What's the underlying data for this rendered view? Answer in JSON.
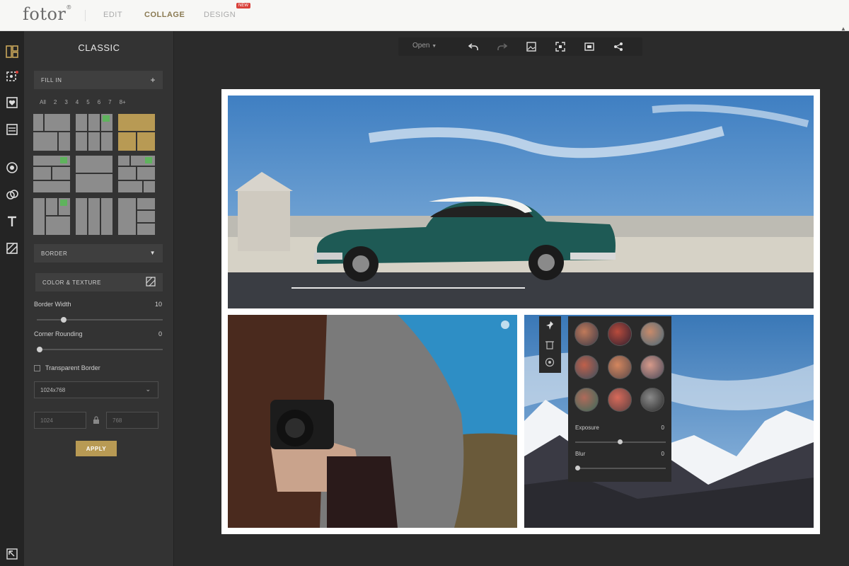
{
  "app": {
    "logo": "fotor",
    "logo_mark": "®"
  },
  "topnav": {
    "edit": "EDIT",
    "collage": "COLLAGE",
    "design": "DESIGN",
    "new_badge": "NEW"
  },
  "panel": {
    "title": "CLASSIC",
    "fill_in": "FILL IN",
    "counts": [
      "All",
      "2",
      "3",
      "4",
      "5",
      "6",
      "7",
      "8+"
    ],
    "border": "BORDER",
    "color_texture": "COLOR & TEXTURE",
    "border_width_label": "Border Width",
    "border_width_value": "10",
    "corner_rounding_label": "Corner Rounding",
    "corner_rounding_value": "0",
    "transparent_border": "Transparent Border",
    "size_select": "1024x768",
    "width_value": "1024",
    "height_value": "768",
    "apply": "APPLY",
    "border_width_level": 0.2,
    "corner_rounding_level": 0
  },
  "toolbar": {
    "open": "Open"
  },
  "adjust": {
    "exposure_label": "Exposure",
    "exposure_value": "0",
    "blur_label": "Blur",
    "blur_value": "0",
    "exposure_level": 0.5,
    "blur_level": 0
  },
  "icons": {
    "rail": [
      "layout-icon",
      "sticker-icon",
      "frame-icon",
      "text-list-icon",
      "star-icon",
      "clipart-icon",
      "text-icon",
      "pattern-icon"
    ],
    "toolbar": [
      "undo-icon",
      "redo-icon",
      "image-icon",
      "fullscreen-icon",
      "crop-icon",
      "share-icon"
    ]
  },
  "colors": {
    "accent": "#b89a54",
    "heart": "#5fb35d",
    "panel": "#333333",
    "canvas_border": "#ffffff"
  }
}
